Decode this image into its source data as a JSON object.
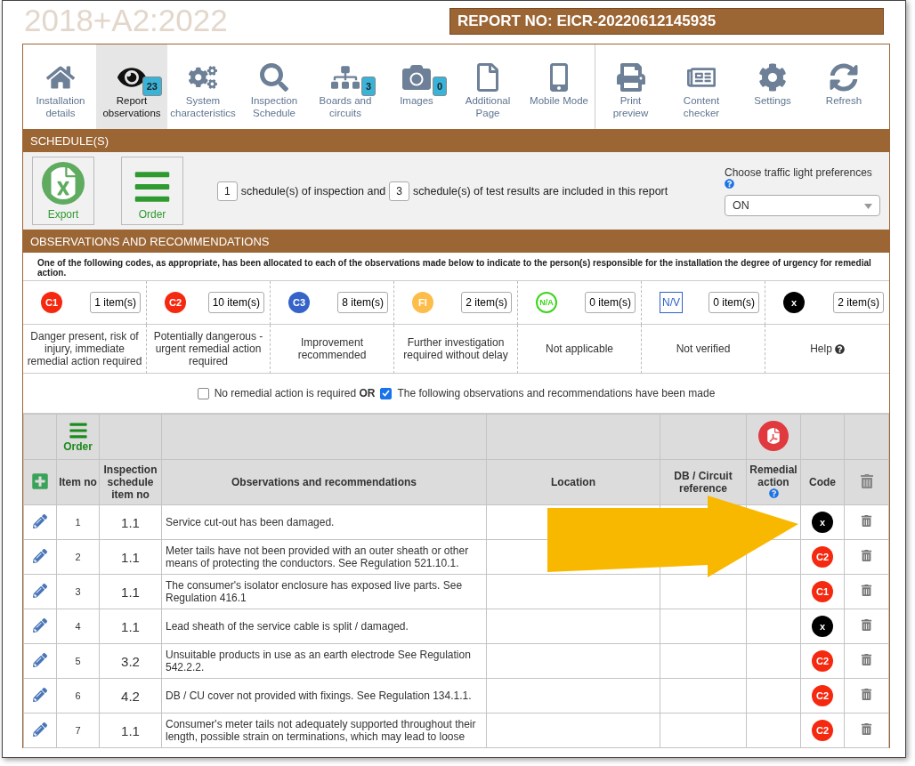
{
  "header": {
    "version": "2018+A2:2022",
    "report_no": "REPORT NO: EICR-20220612145935"
  },
  "toolbar": [
    {
      "label": "Installation details",
      "selected": false
    },
    {
      "label": "Report observations",
      "badge": "23",
      "selected": true
    },
    {
      "label": "System characteristics",
      "selected": false
    },
    {
      "label": "Inspection Schedule",
      "selected": false
    },
    {
      "label": "Boards and circuits",
      "badge": "3",
      "selected": false
    },
    {
      "label": "Images",
      "badge": "0",
      "selected": false
    },
    {
      "label": "Additional Page",
      "selected": false
    },
    {
      "label": "Mobile Mode",
      "selected": false
    },
    {
      "label": "Print preview",
      "selected": false
    },
    {
      "label": "Content checker",
      "selected": false
    },
    {
      "label": "Settings",
      "selected": false
    },
    {
      "label": "Refresh",
      "selected": false
    }
  ],
  "schedules": {
    "title": "SCHEDULE(S)",
    "export_label": "Export",
    "order_label": "Order",
    "inspection_count": "1",
    "text_1": "schedule(s) of inspection and",
    "test_count": "3",
    "text_2": "schedule(s) of test results are included in this report",
    "traffic_label": "Choose traffic light preferences",
    "traffic_value": "ON"
  },
  "observations": {
    "title": "OBSERVATIONS AND RECOMMENDATIONS",
    "intro": "One of the following codes, as appropriate, has been allocated to each of the observations made below to indicate to the person(s) responsible for the installation the degree of urgency for remedial action.",
    "codes": [
      {
        "kind": "dot",
        "code": "C1",
        "color": "#f5290f",
        "count": "1 item(s)",
        "description": "Danger present, risk of injury, immediate remedial action required"
      },
      {
        "kind": "dot",
        "code": "C2",
        "color": "#f5290f",
        "count": "10 item(s)",
        "description": "Potentially dangerous - urgent remedial action required"
      },
      {
        "kind": "dot",
        "code": "C3",
        "color": "#3563c9",
        "count": "8 item(s)",
        "description": "Improvement recommended"
      },
      {
        "kind": "dot",
        "code": "FI",
        "color": "#fdbd4a",
        "count": "2 item(s)",
        "description": "Further investigation required without delay"
      },
      {
        "kind": "ring",
        "code": "N/A",
        "color": "#3ed41c",
        "count": "0 item(s)",
        "description": "Not applicable"
      },
      {
        "kind": "square",
        "code": "N/V",
        "color": "#2f62c7",
        "count": "0 item(s)",
        "description": "Not verified"
      },
      {
        "kind": "dot",
        "code": "x",
        "color": "#000000",
        "count": "2 item(s)",
        "description": "Help",
        "help": true
      }
    ],
    "no_remedial": {
      "label": "No remedial action is required",
      "checked": false
    },
    "or": "OR",
    "made": {
      "label": "The following observations and recommendations have been made",
      "checked": true
    }
  },
  "table": {
    "order_label": "Order",
    "columns": [
      "Item no",
      "Inspection schedule item no",
      "Observations and recommendations",
      "Location",
      "DB / Circuit reference",
      "Remedial action",
      "Code"
    ],
    "rows": [
      {
        "item": "1",
        "schedule_item": "1.1",
        "text": "Service cut-out has been damaged.",
        "code": "x",
        "color": "#000000"
      },
      {
        "item": "2",
        "schedule_item": "1.1",
        "text": "Meter tails have not been provided with an outer sheath or other means of protecting the conductors. See Regulation 521.10.1.",
        "code": "C2",
        "color": "#f5290f"
      },
      {
        "item": "3",
        "schedule_item": "1.1",
        "text": "The consumer's isolator enclosure has exposed live parts. See Regulation 416.1",
        "code": "C1",
        "color": "#f5290f"
      },
      {
        "item": "4",
        "schedule_item": "1.1",
        "text": "Lead sheath of the service cable is split / damaged.",
        "code": "x",
        "color": "#000000"
      },
      {
        "item": "5",
        "schedule_item": "3.2",
        "text": "Unsuitable products in use as an earth electrode See Regulation 542.2.2.",
        "code": "C2",
        "color": "#f5290f"
      },
      {
        "item": "6",
        "schedule_item": "4.2",
        "text": "DB / CU cover not provided with fixings. See Regulation 134.1.1.",
        "code": "C2",
        "color": "#f5290f"
      },
      {
        "item": "7",
        "schedule_item": "1.1",
        "text": "Consumer's meter tails not adequately supported throughout their length, possible strain on terminations, which may lead to loose",
        "code": "C2",
        "color": "#f5290f"
      }
    ]
  }
}
